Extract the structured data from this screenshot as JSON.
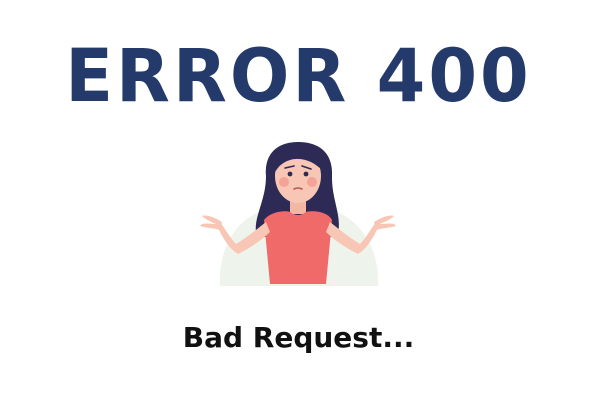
{
  "error": {
    "title": "ERROR 400",
    "message": "Bad Request..."
  },
  "illustration": {
    "icon": "confused-shrug-woman-icon"
  },
  "colors": {
    "title": "#233a6a",
    "message": "#111111",
    "hair": "#2d2a56",
    "skin": "#f7c6b4",
    "shirt": "#f06a6a",
    "backdrop": "#eef4ec",
    "background": "#ffffff"
  }
}
